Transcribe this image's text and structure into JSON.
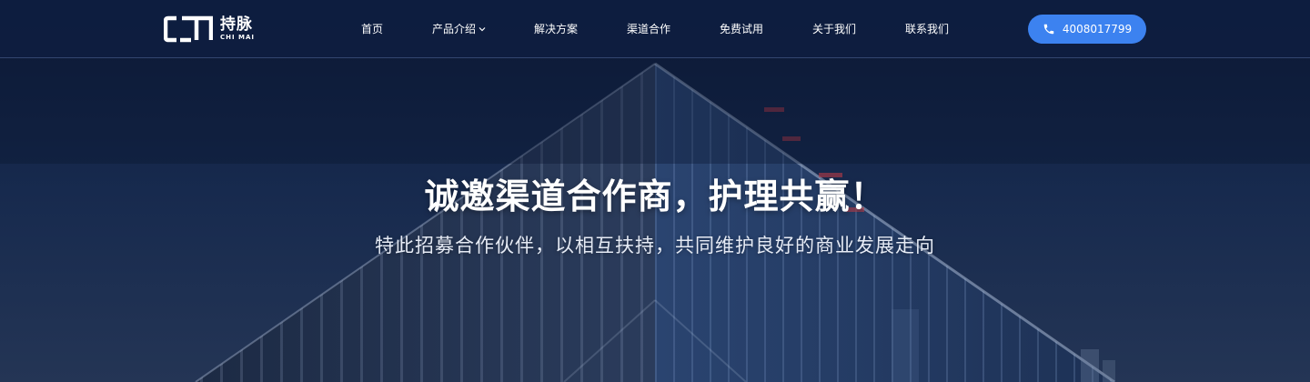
{
  "brand": {
    "name_cn": "持脉",
    "name_en": "CHI MAI"
  },
  "nav": {
    "items": [
      {
        "label": "首页"
      },
      {
        "label": "产品介绍",
        "has_dropdown": true
      },
      {
        "label": "解决方案"
      },
      {
        "label": "渠道合作"
      },
      {
        "label": "免费试用"
      },
      {
        "label": "关于我们"
      },
      {
        "label": "联系我们"
      }
    ]
  },
  "contact": {
    "phone": "4008017799",
    "icon": "phone-icon"
  },
  "hero": {
    "title": "诚邀渠道合作商，护理共赢！",
    "subtitle": "特此招募合作伙伴，以相互扶持，共同维护良好的商业发展走向"
  },
  "colors": {
    "header_bg": "#0e1d40",
    "accent": "#3c82f0",
    "text": "#ffffff"
  }
}
